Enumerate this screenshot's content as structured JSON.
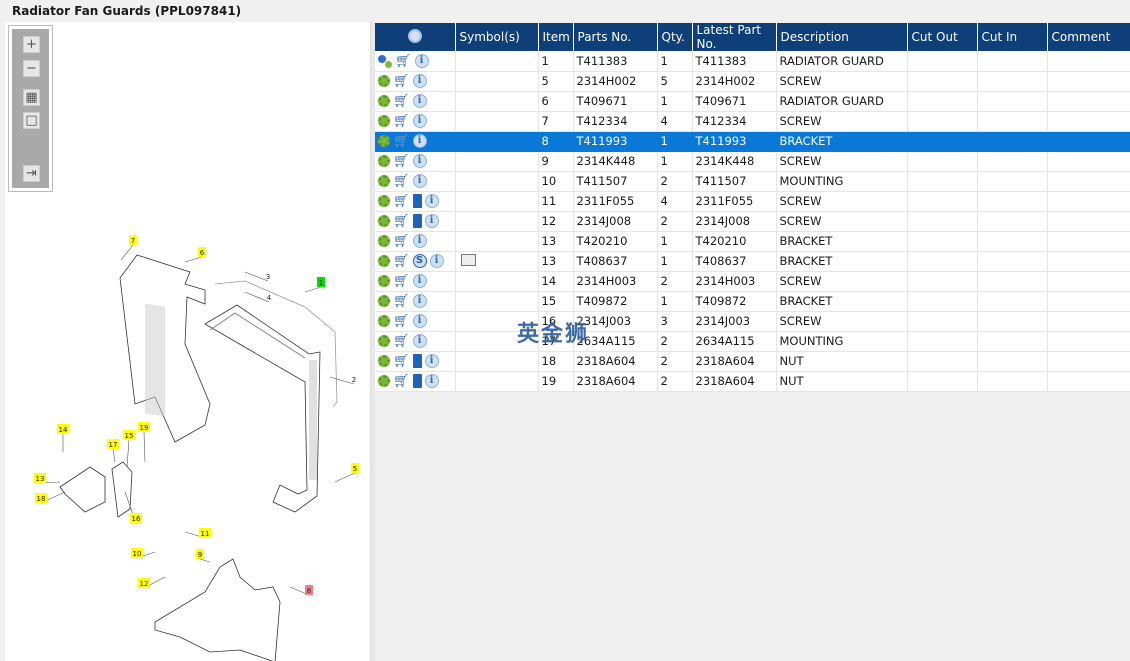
{
  "title": "Radiator Fan Guards (PPL097841)",
  "toolbar": {
    "zoom_in": "+",
    "zoom_out": "−",
    "fit": "▦",
    "actual": "□",
    "export": "⇥"
  },
  "watermark": "英金狮",
  "colors": {
    "header": "#0e3f78",
    "selected": "#0a78d7",
    "callout": "#ffff00",
    "callout_assembly": "#00e000",
    "callout_selected": "#f08080"
  },
  "columns": [
    "",
    "Symbol(s)",
    "Item",
    "Parts No.",
    "Qty.",
    "Latest Part No.",
    "Description",
    "Cut Out",
    "Cut In",
    "Comment"
  ],
  "rows": [
    {
      "icons": [
        "gear-multi",
        "cart",
        "info"
      ],
      "symbol": "",
      "item": "1",
      "part": "T411383",
      "qty": "1",
      "latest": "T411383",
      "desc": "RADIATOR GUARD"
    },
    {
      "icons": [
        "gear",
        "cart",
        "info"
      ],
      "symbol": "",
      "item": "5",
      "part": "2314H002",
      "qty": "5",
      "latest": "2314H002",
      "desc": "SCREW"
    },
    {
      "icons": [
        "gear",
        "cart",
        "info"
      ],
      "symbol": "",
      "item": "6",
      "part": "T409671",
      "qty": "1",
      "latest": "T409671",
      "desc": "RADIATOR GUARD"
    },
    {
      "icons": [
        "gear",
        "cart",
        "info"
      ],
      "symbol": "",
      "item": "7",
      "part": "T412334",
      "qty": "4",
      "latest": "T412334",
      "desc": "SCREW"
    },
    {
      "icons": [
        "gear",
        "cart",
        "info"
      ],
      "symbol": "",
      "item": "8",
      "part": "T411993",
      "qty": "1",
      "latest": "T411993",
      "desc": "BRACKET",
      "selected": true
    },
    {
      "icons": [
        "gear",
        "cart",
        "info"
      ],
      "symbol": "",
      "item": "9",
      "part": "2314K448",
      "qty": "1",
      "latest": "2314K448",
      "desc": "SCREW"
    },
    {
      "icons": [
        "gear",
        "cart",
        "info"
      ],
      "symbol": "",
      "item": "10",
      "part": "T411507",
      "qty": "2",
      "latest": "T411507",
      "desc": "MOUNTING"
    },
    {
      "icons": [
        "gear",
        "cart",
        "book",
        "info"
      ],
      "symbol": "",
      "item": "11",
      "part": "2311F055",
      "qty": "4",
      "latest": "2311F055",
      "desc": "SCREW"
    },
    {
      "icons": [
        "gear",
        "cart",
        "book",
        "info"
      ],
      "symbol": "",
      "item": "12",
      "part": "2314J008",
      "qty": "2",
      "latest": "2314J008",
      "desc": "SCREW"
    },
    {
      "icons": [
        "gear",
        "cart",
        "info"
      ],
      "symbol": "",
      "item": "13",
      "part": "T420210",
      "qty": "1",
      "latest": "T420210",
      "desc": "BRACKET"
    },
    {
      "icons": [
        "gear",
        "cart",
        "s",
        "info"
      ],
      "symbol": "book-search",
      "item": "13",
      "part": "T408637",
      "qty": "1",
      "latest": "T408637",
      "desc": "BRACKET"
    },
    {
      "icons": [
        "gear",
        "cart",
        "info"
      ],
      "symbol": "",
      "item": "14",
      "part": "2314H003",
      "qty": "2",
      "latest": "2314H003",
      "desc": "SCREW"
    },
    {
      "icons": [
        "gear",
        "cart",
        "info"
      ],
      "symbol": "",
      "item": "15",
      "part": "T409872",
      "qty": "1",
      "latest": "T409872",
      "desc": "BRACKET"
    },
    {
      "icons": [
        "gear",
        "cart",
        "info"
      ],
      "symbol": "",
      "item": "16",
      "part": "2314J003",
      "qty": "3",
      "latest": "2314J003",
      "desc": "SCREW"
    },
    {
      "icons": [
        "gear",
        "cart",
        "info"
      ],
      "symbol": "",
      "item": "17",
      "part": "2634A115",
      "qty": "2",
      "latest": "2634A115",
      "desc": "MOUNTING"
    },
    {
      "icons": [
        "gear",
        "cart",
        "book",
        "info"
      ],
      "symbol": "",
      "item": "18",
      "part": "2318A604",
      "qty": "2",
      "latest": "2318A604",
      "desc": "NUT"
    },
    {
      "icons": [
        "gear",
        "cart",
        "book",
        "info"
      ],
      "symbol": "",
      "item": "19",
      "part": "2318A604",
      "qty": "2",
      "latest": "2318A604",
      "desc": "NUT"
    }
  ],
  "callouts": [
    {
      "label": "7",
      "kind": "part"
    },
    {
      "label": "6",
      "kind": "part"
    },
    {
      "label": "3",
      "kind": "plain"
    },
    {
      "label": "4",
      "kind": "plain"
    },
    {
      "label": "1",
      "kind": "assembly"
    },
    {
      "label": "2",
      "kind": "plain"
    },
    {
      "label": "5",
      "kind": "part"
    },
    {
      "label": "14",
      "kind": "part"
    },
    {
      "label": "17",
      "kind": "part"
    },
    {
      "label": "15",
      "kind": "part"
    },
    {
      "label": "19",
      "kind": "part"
    },
    {
      "label": "13",
      "kind": "part"
    },
    {
      "label": "18",
      "kind": "part"
    },
    {
      "label": "16",
      "kind": "part"
    },
    {
      "label": "11",
      "kind": "part"
    },
    {
      "label": "10",
      "kind": "part"
    },
    {
      "label": "9",
      "kind": "part"
    },
    {
      "label": "12",
      "kind": "part"
    },
    {
      "label": "8",
      "kind": "selected"
    }
  ]
}
